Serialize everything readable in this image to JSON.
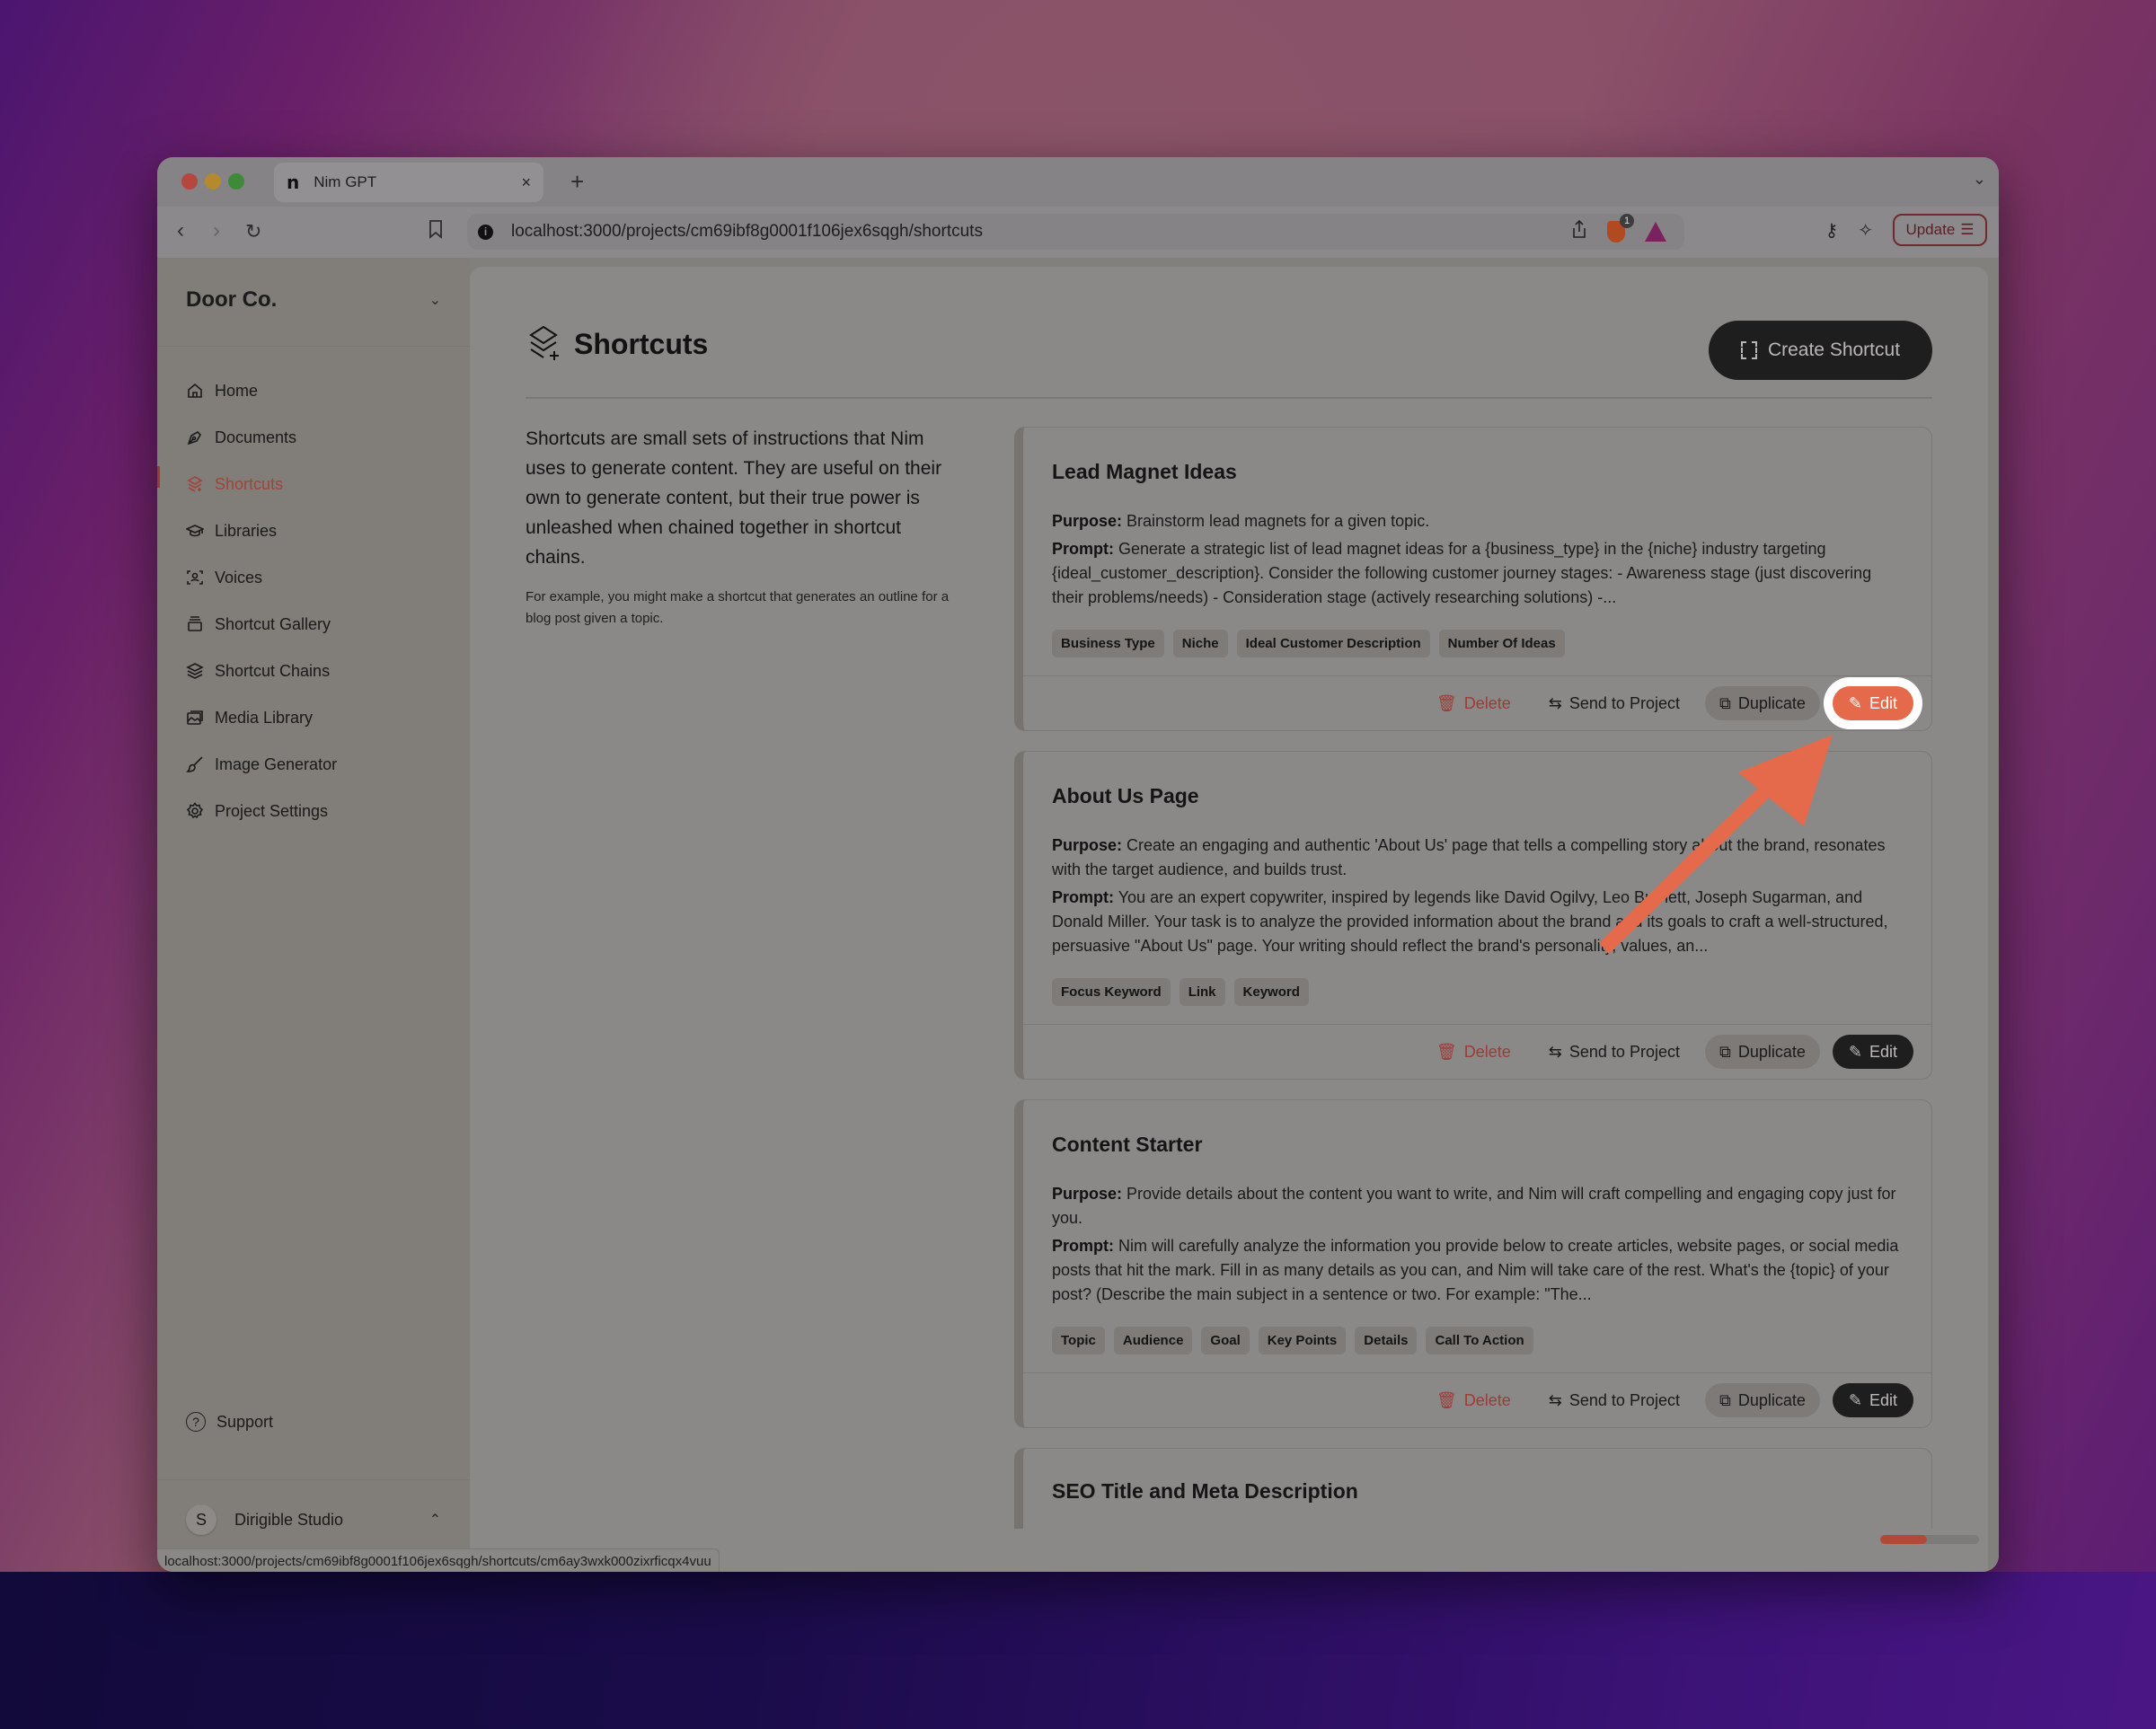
{
  "browser": {
    "tab_title": "Nim GPT",
    "tab_favicon": "n",
    "tab_close": "×",
    "new_tab": "+",
    "url": "localhost:3000/projects/cm69ibf8g0001f106jex6sqgh/shortcuts",
    "shield_badge": "1",
    "update_label": "Update",
    "status_url": "localhost:3000/projects/cm69ibf8g0001f106jex6sqgh/shortcuts/cm6ay3wxk000zixrficqx4vuu"
  },
  "sidebar": {
    "workspace": "Door Co.",
    "items": [
      {
        "label": "Home",
        "icon": "home-icon"
      },
      {
        "label": "Documents",
        "icon": "pen-nib-icon"
      },
      {
        "label": "Shortcuts",
        "icon": "stack-plus-icon",
        "active": true
      },
      {
        "label": "Libraries",
        "icon": "graduation-cap-icon"
      },
      {
        "label": "Voices",
        "icon": "user-scan-icon"
      },
      {
        "label": "Shortcut Gallery",
        "icon": "gallery-icon"
      },
      {
        "label": "Shortcut Chains",
        "icon": "layers-icon"
      },
      {
        "label": "Media Library",
        "icon": "images-icon"
      },
      {
        "label": "Image Generator",
        "icon": "brush-icon"
      },
      {
        "label": "Project Settings",
        "icon": "gear-icon"
      }
    ],
    "support": "Support",
    "user": {
      "initial": "S",
      "name": "Dirigible Studio"
    }
  },
  "main": {
    "title": "Shortcuts",
    "create_button": "Create Shortcut",
    "intro": "Shortcuts are small sets of instructions that Nim uses to generate content. They are useful on their own to generate content, but their true power is unleashed when chained together in shortcut chains.",
    "intro_example": "For example, you might make a shortcut that generates an outline for a blog post given a topic.",
    "labels": {
      "purpose": "Purpose:",
      "prompt": "Prompt:"
    },
    "actions": {
      "delete": "Delete",
      "send": "Send to Project",
      "duplicate": "Duplicate",
      "edit": "Edit"
    },
    "cards": [
      {
        "title": "Lead Magnet Ideas",
        "purpose": "Brainstorm lead magnets for a given topic.",
        "prompt": "Generate a strategic list of lead magnet ideas for a {business_type} in the {niche} industry targeting {ideal_customer_description}. Consider the following customer journey stages: - Awareness stage (just discovering their problems/needs) - Consideration stage (actively researching solutions) -...",
        "tags": [
          "Business Type",
          "Niche",
          "Ideal Customer Description",
          "Number Of Ideas"
        ]
      },
      {
        "title": "About Us Page",
        "purpose": "Create an engaging and authentic 'About Us' page that tells a compelling story about the brand, resonates with the target audience, and builds trust.",
        "prompt": "You are an expert copywriter, inspired by legends like David Ogilvy, Leo Burnett, Joseph Sugarman, and Donald Miller. Your task is to analyze the provided information about the brand and its goals to craft a well-structured, persuasive \"About Us\" page. Your writing should reflect the brand's personality, values, an...",
        "tags": [
          "Focus Keyword",
          "Link",
          "Keyword"
        ]
      },
      {
        "title": "Content Starter",
        "purpose": "Provide details about the content you want to write, and Nim will craft compelling and engaging copy just for you.",
        "prompt": "Nim will carefully analyze the information you provide below to create articles, website pages, or social media posts that hit the mark. Fill in as many details as you can, and Nim will take care of the rest. What's the {topic} of your post? (Describe the main subject in a sentence or two. For example: \"The...",
        "tags": [
          "Topic",
          "Audience",
          "Goal",
          "Key Points",
          "Details",
          "Call To Action"
        ]
      },
      {
        "title": "SEO Title and Meta Description"
      }
    ]
  },
  "colors": {
    "accent": "#e56a4c",
    "active_nav": "#a0443c",
    "delete": "#9a3d37",
    "dark_button": "#1e1e1e"
  }
}
